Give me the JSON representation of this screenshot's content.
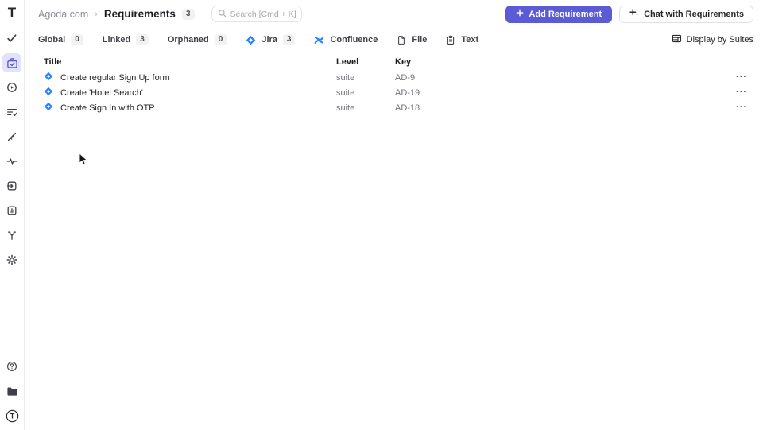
{
  "app": {
    "logo_letter": "T"
  },
  "sidebar": {
    "nav_icons": [
      "check",
      "requirements-case",
      "play-circle",
      "list-check",
      "steps",
      "activity",
      "import-box",
      "report-chart",
      "branch",
      "settings-gear"
    ],
    "active_icon": "requirements-case",
    "bottom_icons": [
      "help-circle",
      "folder",
      "avatar-t"
    ]
  },
  "header": {
    "breadcrumb": {
      "project": "Agoda.com",
      "separator": "›",
      "page": "Requirements",
      "count": "3"
    },
    "search": {
      "placeholder": "Search [Cmd + K]"
    },
    "add_button": "Add Requirement",
    "chat_button": "Chat with Requirements"
  },
  "filters": {
    "chips": [
      {
        "label": "Global",
        "count": "0"
      },
      {
        "label": "Linked",
        "count": "3"
      },
      {
        "label": "Orphaned",
        "count": "0"
      },
      {
        "label": "Jira",
        "count": "3",
        "icon": "jira-logo"
      },
      {
        "label": "Confluence",
        "icon": "confluence-logo"
      },
      {
        "label": "File",
        "icon": "file"
      },
      {
        "label": "Text",
        "icon": "clipboard"
      }
    ],
    "display_by": "Display by Suites"
  },
  "table": {
    "headers": {
      "title": "Title",
      "level": "Level",
      "key": "Key"
    },
    "rows": [
      {
        "title": "Create regular Sign Up form",
        "level": "suite",
        "key": "AD-9"
      },
      {
        "title": "Create 'Hotel Search'",
        "level": "suite",
        "key": "AD-19"
      },
      {
        "title": "Create Sign In with OTP",
        "level": "suite",
        "key": "AD-18"
      }
    ],
    "row_menu_label": "···"
  },
  "colors": {
    "accent": "#5b5bd6",
    "active_nav_bg": "#e3e2fb",
    "jira_blue": "#2684ff",
    "muted_text": "#73737b",
    "badge_bg": "#f2f2f3"
  }
}
